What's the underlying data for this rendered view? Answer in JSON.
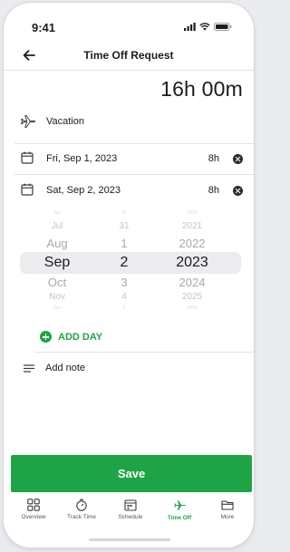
{
  "status_bar": {
    "time": "9:41"
  },
  "header": {
    "title": "Time Off Request"
  },
  "total_hours": "16h 00m",
  "type": {
    "label": "Vacation"
  },
  "days": [
    {
      "date": "Fri, Sep 1, 2023",
      "hours": "8h"
    },
    {
      "date": "Sat, Sep 2, 2023",
      "hours": "8h"
    }
  ],
  "picker": {
    "months": [
      "Jun",
      "Jul",
      "Aug",
      "Sep",
      "Oct",
      "Nov",
      "Dec"
    ],
    "days": [
      "30",
      "31",
      "1",
      "2",
      "3",
      "4",
      "5"
    ],
    "years": [
      "2020",
      "2021",
      "2022",
      "2023",
      "2024",
      "2025",
      "2026"
    ]
  },
  "add_day": {
    "label": "ADD DAY"
  },
  "note": {
    "placeholder": "Add note"
  },
  "save": {
    "label": "Save"
  },
  "tabs": [
    {
      "label": "Overview",
      "icon": "overview-icon"
    },
    {
      "label": "Track Time",
      "icon": "stopwatch-icon"
    },
    {
      "label": "Schedule",
      "icon": "calendar-icon"
    },
    {
      "label": "Time Off",
      "icon": "airplane-icon",
      "active": true
    },
    {
      "label": "More",
      "icon": "folder-icon"
    }
  ],
  "colors": {
    "accent": "#21a346",
    "save_button": "#1ea446"
  }
}
